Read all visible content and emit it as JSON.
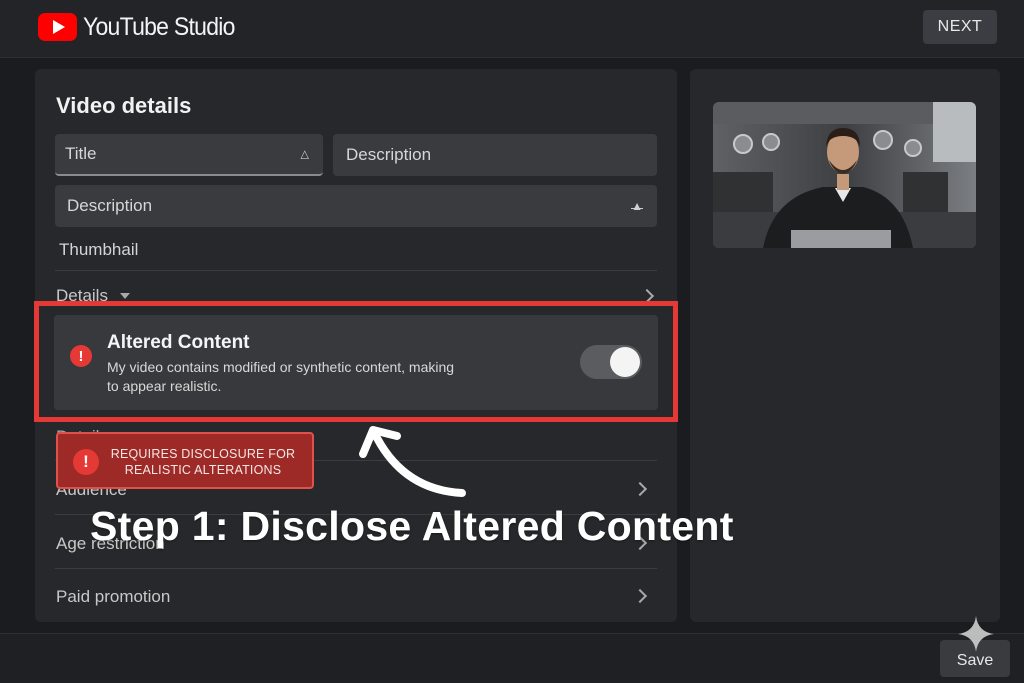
{
  "header": {
    "app_name": "YouTube Studio",
    "next_label": "NEXT"
  },
  "video_details": {
    "heading": "Video details",
    "title_field": {
      "placeholder": "Title"
    },
    "description_field_short": {
      "placeholder": "Description"
    },
    "description_field": {
      "placeholder": "Description"
    },
    "thumbnail_label": "Thumbhail",
    "details_label": "Details",
    "details_label_2": "Details",
    "rows": [
      {
        "label": "Audience"
      },
      {
        "label": "Age restriction"
      },
      {
        "label": "Paid promotion"
      }
    ]
  },
  "altered_content": {
    "title": "Altered Content",
    "description": "My video contains modified or synthetic content, making to appear realistic.",
    "toggle_on": true
  },
  "disclosure_badge": {
    "text": "REQUIRES DISCLOSURE FOR REALISTIC ALTERATIONS"
  },
  "overlay": {
    "step_text": "Step 1: Disclose Altered Content"
  },
  "footer": {
    "save_label": "Save"
  },
  "colors": {
    "accent_red": "#e53935",
    "badge_red": "#9e2a28",
    "panel_bg": "#27282b",
    "page_bg": "#1b1c1f"
  },
  "icons": {
    "logo": "youtube-play-icon",
    "warning": "exclamation-circle-icon",
    "row_chevron": "chevron-right-icon",
    "dropdown": "caret-down-icon",
    "sparkle": "sparkle-icon"
  }
}
